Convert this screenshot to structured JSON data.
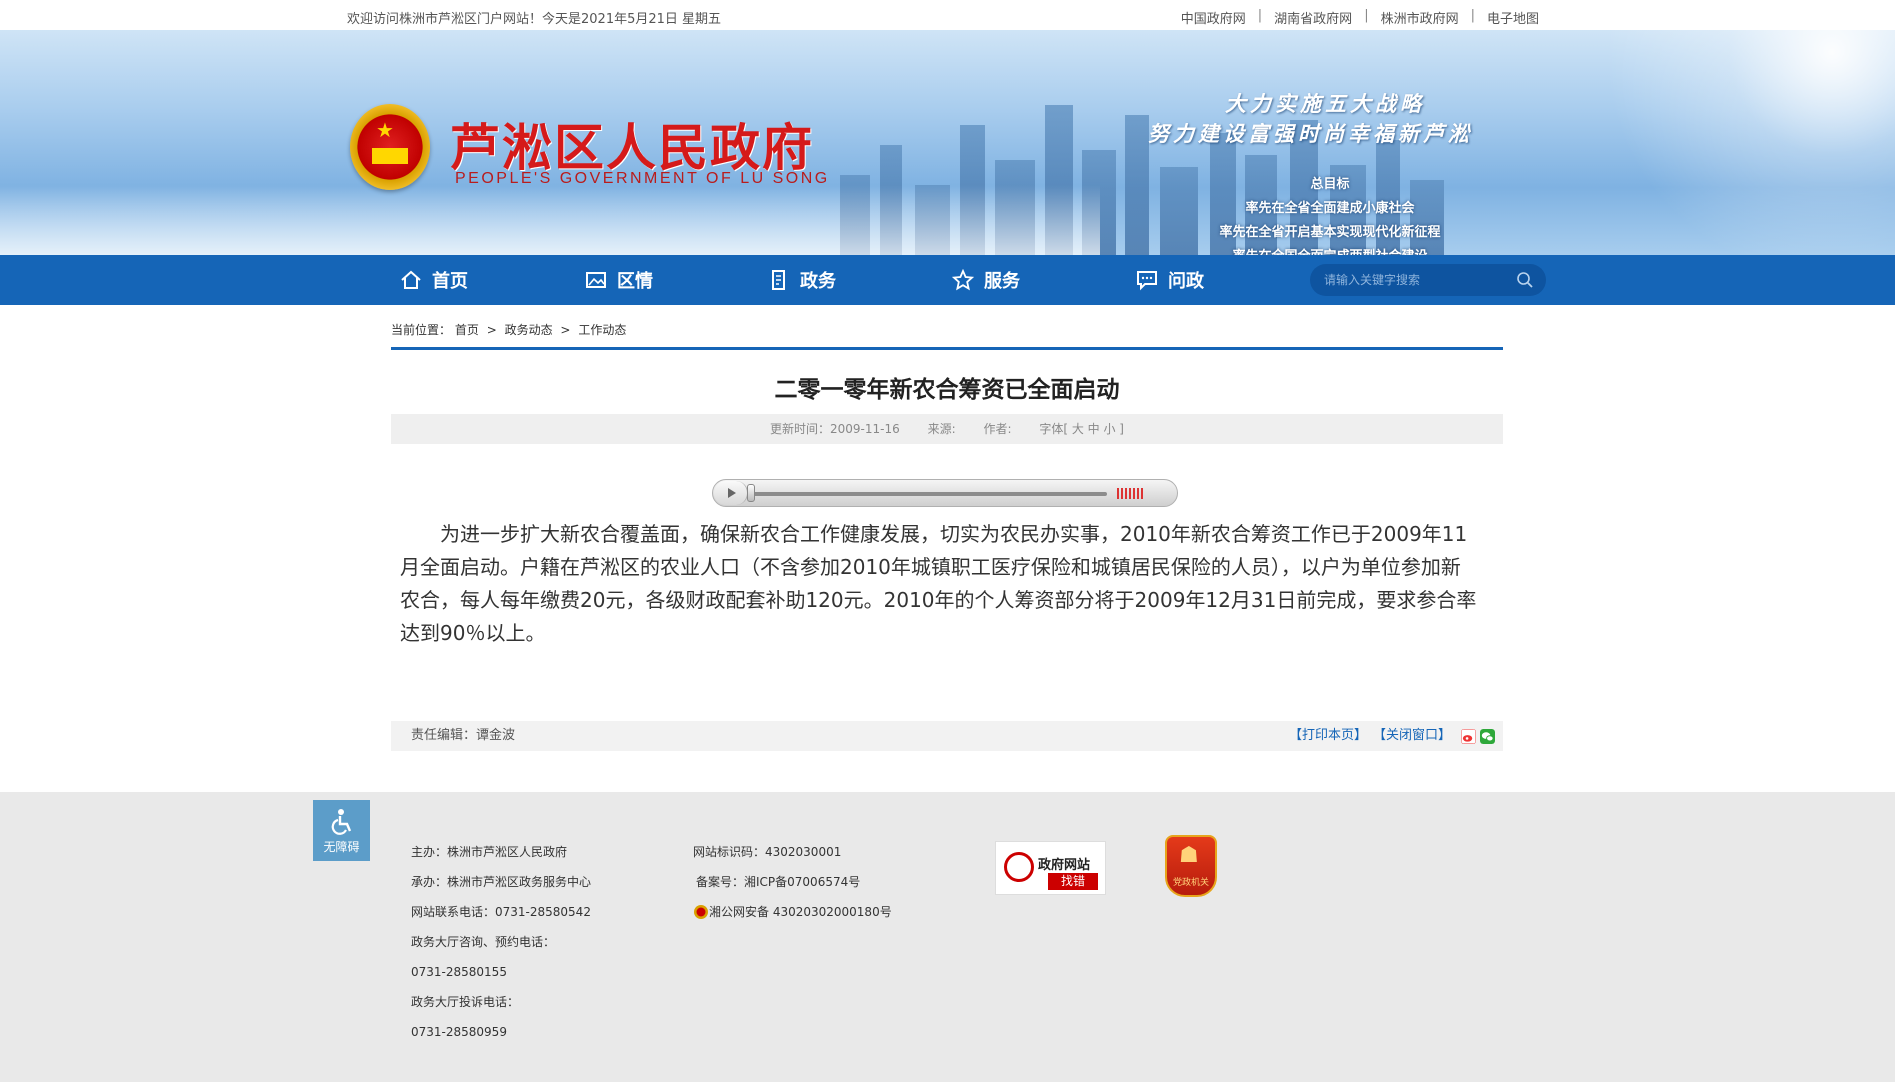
{
  "topbar": {
    "welcome": "欢迎访问株洲市芦淞区门户网站！今天是2021年5月21日 星期五",
    "links": [
      "中国政府网",
      "湖南省政府网",
      "株洲市政府网",
      "电子地图"
    ],
    "separator": "|"
  },
  "banner": {
    "title": "芦淞区人民政府",
    "subtitle": "PEOPLE'S GOVERNMENT OF  LU SONG",
    "slogan_line1": "大力实施五大战略",
    "slogan_line2": "努力建设富强时尚幸福新芦淞",
    "goals": [
      "总目标",
      "率先在全省全面建成小康社会",
      "率先在全省开启基本实现现代化新征程",
      "率先在全国全面完成两型社会建设"
    ]
  },
  "nav": {
    "items": [
      {
        "label": "首页",
        "icon": "home-icon"
      },
      {
        "label": "区情",
        "icon": "picture-icon"
      },
      {
        "label": "政务",
        "icon": "document-icon"
      },
      {
        "label": "服务",
        "icon": "star-icon"
      },
      {
        "label": "问政",
        "icon": "chat-icon"
      }
    ],
    "search_placeholder": "请输入关键字搜索"
  },
  "breadcrumb": {
    "prefix": "当前位置：",
    "items": [
      "首页",
      "政务动态",
      "工作动态"
    ],
    "arrow": ">"
  },
  "article": {
    "title": "二零一零年新农合筹资已全面启动",
    "updated_label": "更新时间：2009-11-16",
    "source_label": "来源:",
    "author_label": "作者:",
    "font_label": "字体[ 大 中 小 ]",
    "body": "为进一步扩大新农合覆盖面，确保新农合工作健康发展，切实为农民办实事，2010年新农合筹资工作已于2009年11月全面启动。户籍在芦淞区的农业人口（不含参加2010年城镇职工医疗保险和城镇居民保险的人员），以户为单位参加新农合，每人每年缴费20元，各级财政配套补助120元。2010年的个人筹资部分将于2009年12月31日前完成，要求参合率达到90％以上。",
    "editor": "责任编辑：谭金波",
    "print": "【打印本页】",
    "close": "【关闭窗口】"
  },
  "footer": {
    "accessibility": "无障碍",
    "col1": [
      "主办：株洲市芦淞区人民政府",
      "承办：株洲市芦淞区政务服务中心",
      "网站联系电话：0731-28580542",
      "政务大厅咨询、预约电话：",
      "0731-28580155",
      "政务大厅投诉电话：",
      "0731-28580959"
    ],
    "col2": [
      "网站标识码：4302030001",
      "备案号：湘ICP备07006574号",
      "湘公网安备 43020302000180号"
    ],
    "badge_error_line1": "政府网站",
    "badge_error_line2": "找错",
    "badge_party": "党政机关"
  },
  "colors": {
    "nav_blue": "#1565b7",
    "title_red": "#d51a1a",
    "link_blue": "#1565b7"
  }
}
